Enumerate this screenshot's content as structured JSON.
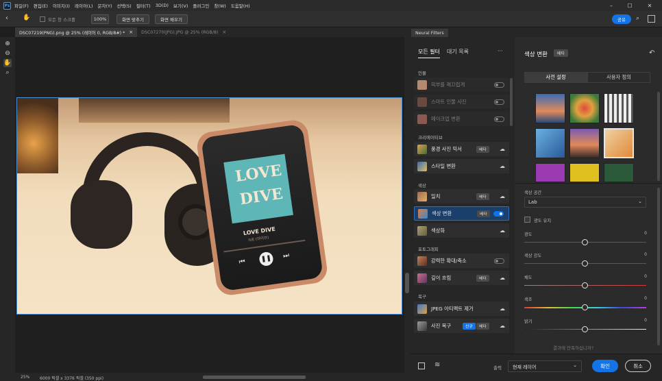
{
  "menubar": {
    "items": [
      "파일(F)",
      "편집(E)",
      "이미지(I)",
      "레이어(L)",
      "문자(Y)",
      "선택(S)",
      "필터(T)",
      "3D(D)",
      "보기(V)",
      "플러그인",
      "창(W)",
      "도움말(H)"
    ]
  },
  "options": {
    "scroll_all_label": "모든 창 스크롤",
    "zoom_value": "100%",
    "fit_screen_label": "화면 맞추기",
    "fill_screen_label": "화면 채우기",
    "share_label": "공유"
  },
  "documents": {
    "active_tab": "DSC07219(PNG).png @ 25% (레이어 0, RGB/8#) *",
    "inactive_tab": "DSC07270(JPG).JPG @ 25% (RGB/8)"
  },
  "photo": {
    "phone_title_line1": "LOVE",
    "phone_title_line2": "DIVE",
    "song_title": "LOVE DIVE",
    "artist": "IVE (아이브)"
  },
  "status": {
    "zoom": "25%",
    "doc_info": "6000 픽셀 x 3376 픽셀 (350 ppi)"
  },
  "neural_filters": {
    "panel_title": "Neural Filters",
    "tab_all": "모든 필터",
    "tab_wait": "대기 목록",
    "more_icon_text": "···",
    "badge_beta": "베타",
    "badge_new": "신규",
    "sections": {
      "portrait": "인물",
      "creative": "크리에이티브",
      "color": "색상",
      "photography": "포토그래피",
      "restore": "복구"
    },
    "filters": {
      "skin": "피부를 매끄럽게",
      "smart_portrait": "스마트 인물 사진",
      "makeup": "메이크업 변환",
      "landscape": "풍경 사진 믹서",
      "style": "스타일 변환",
      "harmonize": "일치",
      "color_transfer": "색상 변환",
      "colorize": "색상화",
      "super_zoom": "강력한 확대/축소",
      "depth_blur": "깊이 흐림",
      "jpeg": "JPEG 아티팩트 제거",
      "photo_restore": "사진 복구"
    }
  },
  "settings": {
    "title": "색상 변환",
    "preset_tab": "사전 설정",
    "custom_tab": "사용자 정의",
    "color_space_label": "색상 공간",
    "color_space_value": "Lab",
    "preserve_lum_label": "광도 유지",
    "sliders": [
      {
        "label": "광도",
        "value": "0"
      },
      {
        "label": "색상 강도",
        "value": "0"
      },
      {
        "label": "채도",
        "value": "0"
      },
      {
        "label": "색조",
        "value": "0"
      },
      {
        "label": "밝기",
        "value": "0"
      }
    ],
    "footer_note": "결과에 만족하십니까?"
  },
  "footer": {
    "output_label": "출력",
    "output_value": "현재 레이어",
    "ok_label": "확인",
    "cancel_label": "취소"
  },
  "colors": {
    "accent": "#1473e6",
    "panel_bg": "#262626",
    "selected_row": "#1b3f6b"
  }
}
